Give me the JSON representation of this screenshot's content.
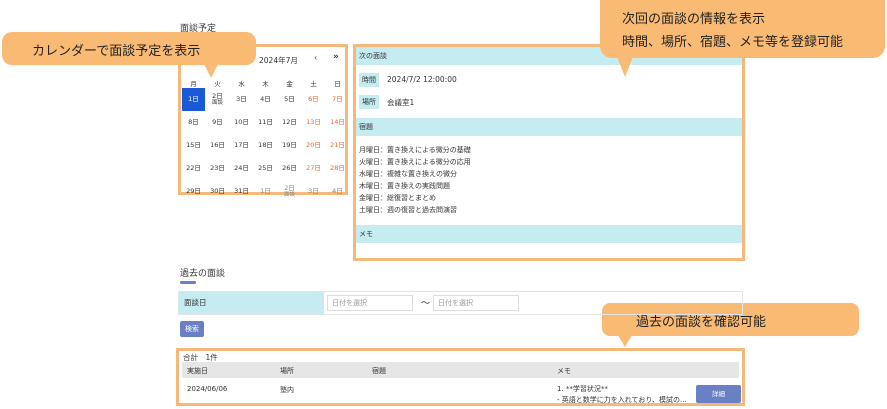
{
  "page": {
    "title": "面談予定"
  },
  "calendar": {
    "month_label": "2024年7月",
    "prev": "‹",
    "next": "»",
    "weekdays": [
      "月",
      "火",
      "水",
      "木",
      "金",
      "土",
      "日"
    ],
    "days": [
      [
        "1日",
        "",
        "sel"
      ],
      [
        "2日",
        "面談",
        ""
      ],
      [
        "3日",
        "",
        ""
      ],
      [
        "4日",
        "",
        ""
      ],
      [
        "5日",
        "",
        ""
      ],
      [
        "6日",
        "",
        "we"
      ],
      [
        "7日",
        "",
        "we"
      ],
      [
        "8日",
        "",
        ""
      ],
      [
        "9日",
        "",
        ""
      ],
      [
        "10日",
        "",
        ""
      ],
      [
        "11日",
        "",
        ""
      ],
      [
        "12日",
        "",
        ""
      ],
      [
        "13日",
        "",
        "we"
      ],
      [
        "14日",
        "",
        "we"
      ],
      [
        "15日",
        "",
        ""
      ],
      [
        "16日",
        "",
        ""
      ],
      [
        "17日",
        "",
        ""
      ],
      [
        "18日",
        "",
        ""
      ],
      [
        "19日",
        "",
        ""
      ],
      [
        "20日",
        "",
        "we"
      ],
      [
        "21日",
        "",
        "we"
      ],
      [
        "22日",
        "",
        ""
      ],
      [
        "23日",
        "",
        ""
      ],
      [
        "24日",
        "",
        ""
      ],
      [
        "25日",
        "",
        ""
      ],
      [
        "26日",
        "",
        ""
      ],
      [
        "27日",
        "",
        "we"
      ],
      [
        "28日",
        "",
        "we"
      ],
      [
        "29日",
        "",
        ""
      ],
      [
        "30日",
        "",
        ""
      ],
      [
        "31日",
        "",
        ""
      ],
      [
        "1日",
        "",
        "oth"
      ],
      [
        "2日",
        "面談",
        "oth"
      ],
      [
        "3日",
        "",
        "oth"
      ],
      [
        "4日",
        "",
        "oth"
      ]
    ]
  },
  "next_meeting": {
    "header": "次の面談",
    "time_label": "時間",
    "time_value": "2024/7/2 12:00:00",
    "place_label": "場所",
    "place_value": "会議室1",
    "homework_label": "宿題",
    "homework": [
      "月曜日：置き換えによる微分の基礎",
      "火曜日：置き換えによる微分の応用",
      "水曜日：複雑な置き換えの微分",
      "木曜日：置き換えの実践問題",
      "金曜日：総復習とまとめ",
      "土曜日：週の復習と過去問演習"
    ],
    "memo_label": "メモ"
  },
  "callouts": {
    "calendar": "カレンダーで面談予定を表示",
    "next_line1": "次回の面談の情報を表示",
    "next_line2": "時間、場所、宿題、メモ等を登録可能",
    "past": "過去の面談を確認可能"
  },
  "past_meetings": {
    "title": "過去の面談",
    "filter_label": "面談日",
    "from_placeholder": "日付を選択",
    "tilde": "〜",
    "to_placeholder": "日付を選択",
    "search_button": "検索",
    "total": "合計　1件",
    "columns": [
      "実施日",
      "場所",
      "宿題",
      "メモ"
    ],
    "row": {
      "date": "2024/06/06",
      "place": "塾内",
      "homework": "",
      "memo_line1": "1. **学習状況**",
      "memo_line2": "- 英語と数学に力を入れており、模試の..."
    },
    "detail_button": "詳細"
  },
  "colors": {
    "accent": "#6b7fc4",
    "highlight_bg": "#c5ecf1",
    "callout": "#f9ba74",
    "selected_day": "#1a5ad6",
    "weekend": "#e06a2e"
  }
}
